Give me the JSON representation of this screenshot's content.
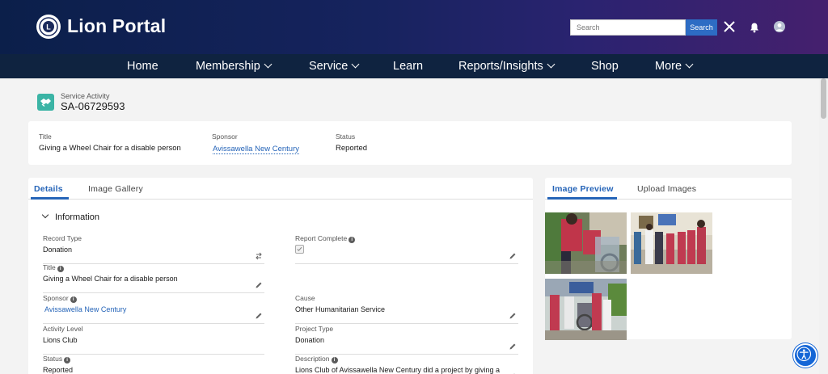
{
  "header": {
    "brand": "Lion Portal",
    "search_placeholder": "Search",
    "search_button": "Search",
    "icons": [
      "lions-logo-icon",
      "close-icon",
      "bell-icon",
      "user-avatar-icon"
    ]
  },
  "nav": {
    "items": [
      {
        "label": "Home"
      },
      {
        "label": "Membership"
      },
      {
        "label": "Service"
      },
      {
        "label": "Learn"
      },
      {
        "label": "Reports/Insights"
      },
      {
        "label": "Shop"
      },
      {
        "label": "More"
      }
    ]
  },
  "record": {
    "type": "Service Activity",
    "number": "SA-06729593"
  },
  "highlights": {
    "title_label": "Title",
    "title_value": "Giving a Wheel Chair for a disable person",
    "sponsor_label": "Sponsor",
    "sponsor_value": "Avissawella New Century",
    "status_label": "Status",
    "status_value": "Reported"
  },
  "left_tabs": {
    "details": "Details",
    "gallery": "Image Gallery"
  },
  "section": {
    "title": "Information"
  },
  "fields": {
    "record_type": {
      "label": "Record Type",
      "value": "Donation"
    },
    "title": {
      "label": "Title",
      "value": "Giving a Wheel Chair for a disable person"
    },
    "sponsor": {
      "label": "Sponsor",
      "value": "Avissawella New Century"
    },
    "activity_level": {
      "label": "Activity Level",
      "value": "Lions Club"
    },
    "status": {
      "label": "Status",
      "value": "Reported"
    },
    "report_complete": {
      "label": "Report Complete",
      "checked": true
    },
    "cause": {
      "label": "Cause",
      "value": "Other Humanitarian Service"
    },
    "project_type": {
      "label": "Project Type",
      "value": "Donation"
    },
    "description": {
      "label": "Description",
      "value": "Lions Club of Avissawella New Century did a project by giving a"
    }
  },
  "right_tabs": {
    "preview": "Image Preview",
    "upload": "Upload Images"
  },
  "colors": {
    "accent": "#2564b8",
    "nav_bg": "#0f2340",
    "record_icon": "#3bb4a5"
  }
}
